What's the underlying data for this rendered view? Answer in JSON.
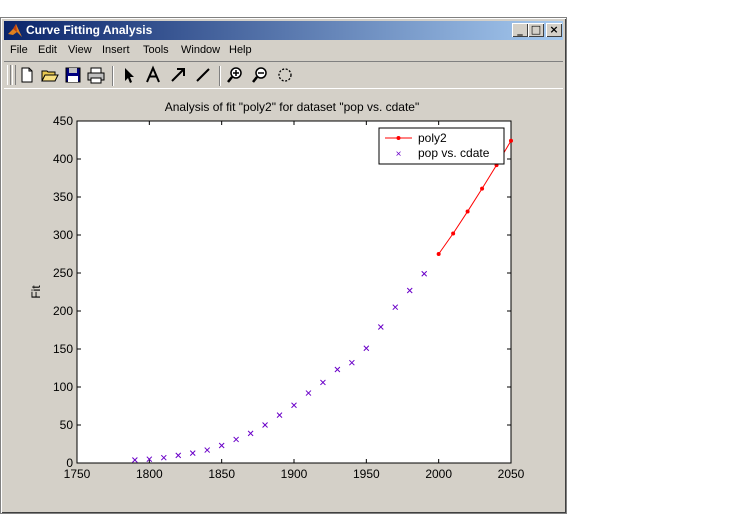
{
  "window": {
    "title": "Curve Fitting Analysis",
    "controls": {
      "minimize": "_",
      "maximize": "□",
      "close": "×"
    }
  },
  "menu": [
    "File",
    "Edit",
    "View",
    "Insert",
    "Tools",
    "Window",
    "Help"
  ],
  "toolbar": [
    "new-file-icon",
    "open-folder-icon",
    "save-icon",
    "print-icon",
    "pointer-arrow-icon",
    "text-tool-icon",
    "arrow-tool-icon",
    "line-tool-icon",
    "zoom-in-icon",
    "zoom-out-icon",
    "rotate-icon"
  ],
  "colors": {
    "fit_line": "#ff0000",
    "data_marker": "#6a00c8",
    "title_gradient_start": "#0a246a",
    "title_gradient_end": "#a6caf0"
  },
  "chart_data": {
    "type": "scatter",
    "title": "Analysis of fit \"poly2\" for dataset \"pop vs. cdate\"",
    "xlabel": "",
    "ylabel": "Fit",
    "xlim": [
      1750,
      2050
    ],
    "ylim": [
      0,
      450
    ],
    "xticks": [
      1750,
      1800,
      1850,
      1900,
      1950,
      2000,
      2050
    ],
    "yticks": [
      0,
      50,
      100,
      150,
      200,
      250,
      300,
      350,
      400,
      450
    ],
    "grid": false,
    "legend_position": "top-right",
    "series": [
      {
        "name": "poly2",
        "style": "line-dots",
        "x": [
          2000,
          2010,
          2020,
          2030,
          2040,
          2050
        ],
        "y": [
          275,
          302,
          331,
          361,
          392,
          424
        ]
      },
      {
        "name": "pop vs. cdate",
        "style": "x-marker",
        "x": [
          1790,
          1800,
          1810,
          1820,
          1830,
          1840,
          1850,
          1860,
          1870,
          1880,
          1890,
          1900,
          1910,
          1920,
          1930,
          1940,
          1950,
          1960,
          1970,
          1980,
          1990
        ],
        "y": [
          4,
          5,
          7,
          10,
          13,
          17,
          23,
          31,
          39,
          50,
          63,
          76,
          92,
          106,
          123,
          132,
          151,
          179,
          205,
          227,
          249
        ]
      }
    ]
  }
}
